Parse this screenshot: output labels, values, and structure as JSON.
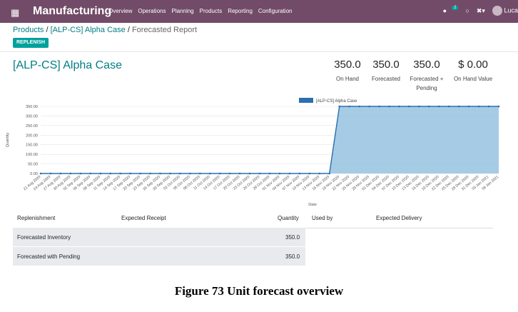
{
  "topbar": {
    "app_name": "Manufacturing",
    "menu": [
      "Overview",
      "Operations",
      "Planning",
      "Products",
      "Reporting",
      "Configuration"
    ],
    "chat_count": "2",
    "user": "Luca"
  },
  "breadcrumb": {
    "products": "Products",
    "product": "[ALP-CS] Alpha Case",
    "current": "Forecasted Report"
  },
  "replenish_label": "REPLENISH",
  "product_title": "[ALP-CS] Alpha Case",
  "stats": [
    {
      "value": "350.0",
      "label": "On Hand"
    },
    {
      "value": "350.0",
      "label": "Forecasted"
    },
    {
      "value": "350.0",
      "label": "Forecasted + Pending"
    },
    {
      "value": "$ 0.00",
      "label": "On Hand Value"
    }
  ],
  "colors": {
    "topbar": "#714B67",
    "accent": "#017e84",
    "button": "#00A09D",
    "area": "#9cc5e1",
    "line": "#2a6fb0"
  },
  "chart_data": {
    "type": "area",
    "legend": "[ALP-CS] Alpha Case",
    "legend_position": "top-center",
    "ylabel": "Quantity",
    "xlabel": "Date",
    "ylim": [
      0,
      350
    ],
    "y_ticks": [
      "0.00",
      "50.00",
      "100.00",
      "150.00",
      "200.00",
      "250.00",
      "300.00",
      "350.00"
    ],
    "grid": true,
    "x": [
      "21 Aug 2020",
      "24 Aug 2020",
      "27 Aug 2020",
      "30 Aug 2020",
      "02 Sep 2020",
      "05 Sep 2020",
      "08 Sep 2020",
      "11 Sep 2020",
      "14 Sep 2020",
      "17 Sep 2020",
      "20 Sep 2020",
      "23 Sep 2020",
      "26 Sep 2020",
      "29 Sep 2020",
      "02 Oct 2020",
      "05 Oct 2020",
      "08 Oct 2020",
      "11 Oct 2020",
      "14 Oct 2020",
      "17 Oct 2020",
      "20 Oct 2020",
      "23 Oct 2020",
      "26 Oct 2020",
      "29 Oct 2020",
      "01 Nov 2020",
      "04 Nov 2020",
      "07 Nov 2020",
      "10 Nov 2020",
      "13 Nov 2020",
      "16 Nov 2020",
      "19 Nov 2020",
      "22 Nov 2020",
      "25 Nov 2020",
      "28 Nov 2020",
      "01 Dec 2020",
      "04 Dec 2020",
      "07 Dec 2020",
      "10 Dec 2020",
      "13 Dec 2020",
      "16 Dec 2020",
      "19 Dec 2020",
      "22 Dec 2020",
      "25 Dec 2020",
      "28 Dec 2020",
      "31 Dec 2020",
      "03 Jan 2021",
      "06 Jan 2021"
    ],
    "values": [
      0,
      0,
      0,
      0,
      0,
      0,
      0,
      0,
      0,
      0,
      0,
      0,
      0,
      0,
      0,
      0,
      0,
      0,
      0,
      0,
      0,
      0,
      0,
      0,
      0,
      0,
      0,
      0,
      0,
      0,
      350,
      350,
      350,
      350,
      350,
      350,
      350,
      350,
      350,
      350,
      350,
      350,
      350,
      350,
      350,
      350,
      350
    ]
  },
  "table": {
    "headers": [
      "Replenishment",
      "Expected Receipt",
      "Quantity",
      "Used by",
      "Expected Delivery"
    ],
    "rows": [
      {
        "label": "Forecasted Inventory",
        "quantity": "350.0"
      },
      {
        "label": "Forecasted with Pending",
        "quantity": "350.0"
      }
    ]
  },
  "caption": "Figure 73 Unit forecast overview"
}
